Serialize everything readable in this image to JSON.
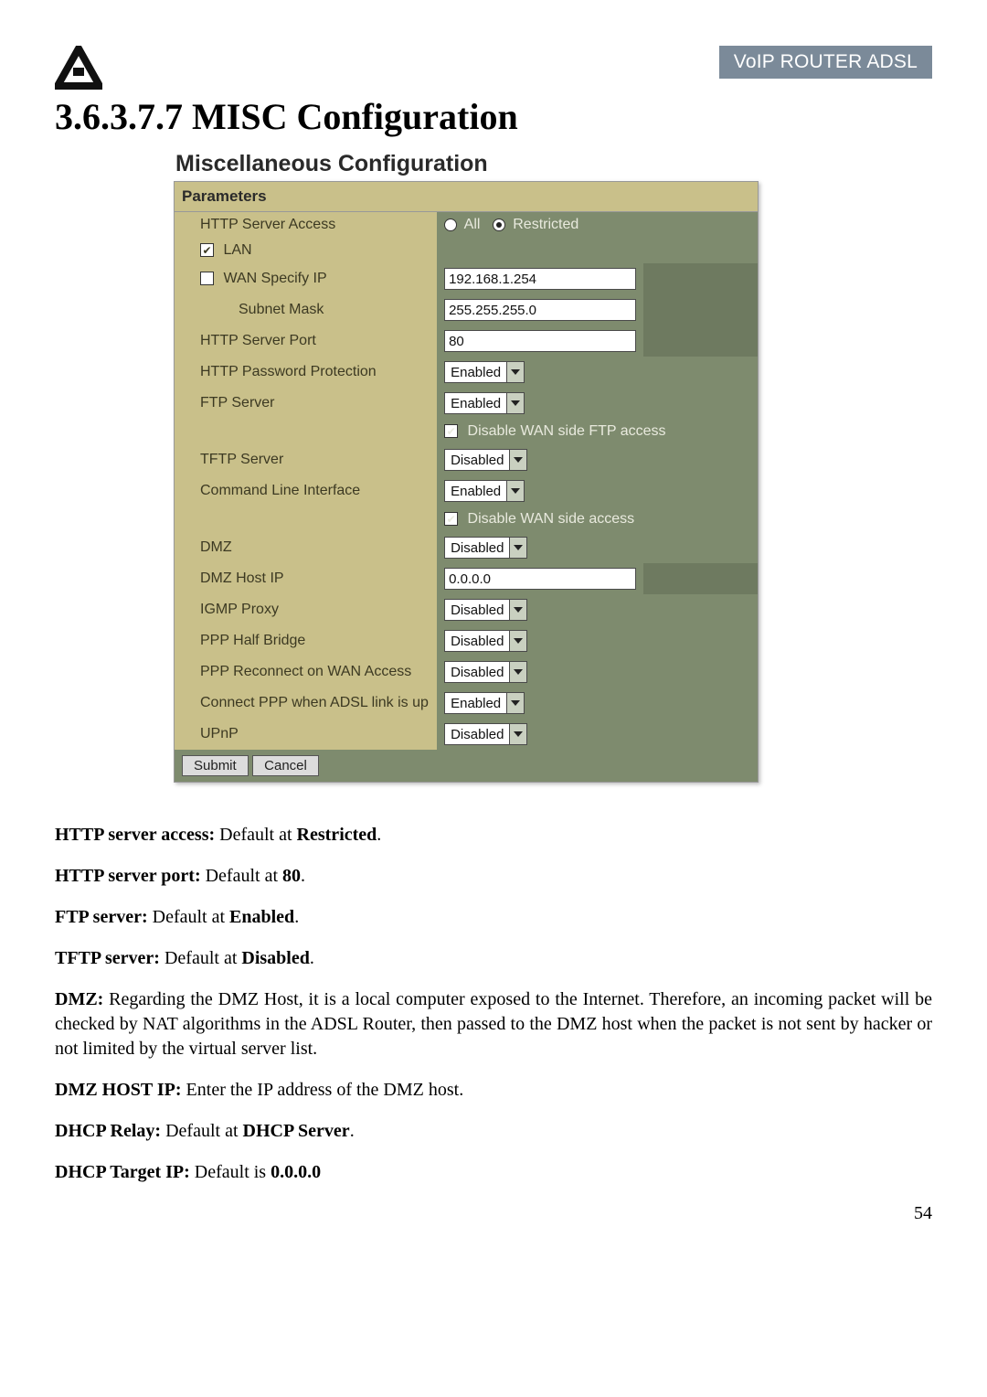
{
  "header": {
    "badge": "VoIP ROUTER ADSL",
    "title": "3.6.3.7.7 MISC Configuration"
  },
  "panel": {
    "title": "Miscellaneous Configuration",
    "subheader": "Parameters",
    "rows": {
      "http_server_access": {
        "label": "HTTP Server Access",
        "all": "All",
        "restricted": "Restricted"
      },
      "lan": {
        "label": "LAN",
        "checked": true
      },
      "wan_specify_ip": {
        "label": "WAN Specify IP",
        "checked": false,
        "value": "192.168.1.254"
      },
      "subnet_mask": {
        "label": "Subnet Mask",
        "value": "255.255.255.0"
      },
      "http_server_port": {
        "label": "HTTP Server Port",
        "value": "80"
      },
      "http_password_protection": {
        "label": "HTTP Password Protection",
        "value": "Enabled"
      },
      "ftp_server": {
        "label": "FTP Server",
        "value": "Enabled"
      },
      "disable_wan_ftp": {
        "label": "Disable WAN side FTP access",
        "checked": true
      },
      "tftp_server": {
        "label": "TFTP Server",
        "value": "Disabled"
      },
      "cli": {
        "label": "Command Line Interface",
        "value": "Enabled"
      },
      "disable_wan_access": {
        "label": "Disable WAN side access",
        "checked": true
      },
      "dmz": {
        "label": "DMZ",
        "value": "Disabled"
      },
      "dmz_host_ip": {
        "label": "DMZ Host IP",
        "value": "0.0.0.0"
      },
      "igmp_proxy": {
        "label": "IGMP Proxy",
        "value": "Disabled"
      },
      "ppp_half_bridge": {
        "label": "PPP Half Bridge",
        "value": "Disabled"
      },
      "ppp_reconnect": {
        "label": "PPP Reconnect on WAN Access",
        "value": "Disabled"
      },
      "connect_ppp_adsl": {
        "label": "Connect PPP when ADSL link is up",
        "value": "Enabled"
      },
      "upnp": {
        "label": "UPnP",
        "value": "Disabled"
      }
    },
    "buttons": {
      "submit": "Submit",
      "cancel": "Cancel"
    }
  },
  "body": {
    "p1_label": "HTTP server access:",
    "p1_rest": " Default at ",
    "p1_val": "Restricted",
    "p2_label": "HTTP server port:",
    "p2_rest": " Default at ",
    "p2_val": "80",
    "p3_label": "FTP server:",
    "p3_rest": " Default at ",
    "p3_val": "Enabled",
    "p4_label": "TFTP server:",
    "p4_rest": " Default at ",
    "p4_val": "Disabled",
    "p5_label": "DMZ:",
    "p5_rest": " Regarding the DMZ Host, it is a local computer exposed to the Internet. Therefore, an incoming packet will be checked by NAT algorithms in the ADSL Router, then passed to the DMZ host when the packet is not sent by hacker or not limited by the virtual server list.",
    "p6_label": "DMZ HOST IP:",
    "p6_rest": " Enter the IP address of the DMZ host.",
    "p7_label": "DHCP Relay:",
    "p7_rest": " Default at ",
    "p7_val": "DHCP Server",
    "p8_label": "DHCP Target IP:",
    "p8_rest": " Default is ",
    "p8_val": "0.0.0.0"
  },
  "page_number": "54"
}
